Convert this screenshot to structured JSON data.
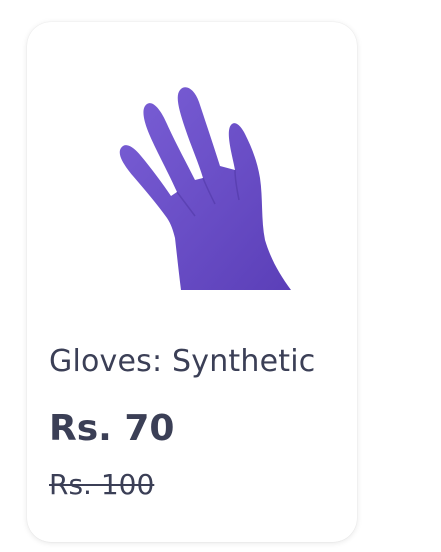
{
  "product": {
    "name": "Gloves: Synthetic",
    "price_current": "Rs. 70",
    "price_original": "Rs. 100",
    "image_icon": "purple-glove",
    "image_color": "#6a4fc7"
  },
  "colors": {
    "text": "#3b3f56",
    "card_background": "#ffffff"
  }
}
